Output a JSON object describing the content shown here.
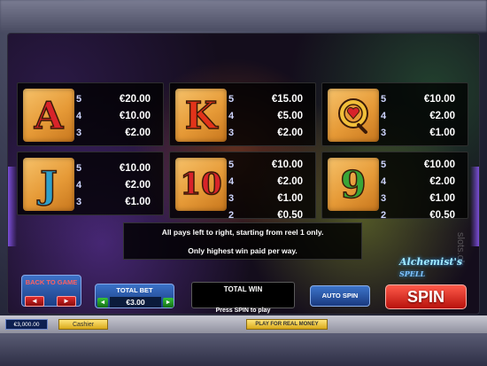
{
  "paytable": [
    {
      "symbol": "A",
      "color": "#d8232a",
      "pays": [
        {
          "count": "5",
          "value": "€20.00"
        },
        {
          "count": "4",
          "value": "€10.00"
        },
        {
          "count": "3",
          "value": "€2.00"
        }
      ]
    },
    {
      "symbol": "K",
      "color": "#e2331a",
      "pays": [
        {
          "count": "5",
          "value": "€15.00"
        },
        {
          "count": "4",
          "value": "€5.00"
        },
        {
          "count": "3",
          "value": "€2.00"
        }
      ]
    },
    {
      "symbol": "Q",
      "color": "#f1bf3a",
      "pays": [
        {
          "count": "5",
          "value": "€10.00"
        },
        {
          "count": "4",
          "value": "€2.00"
        },
        {
          "count": "3",
          "value": "€1.00"
        }
      ]
    },
    {
      "symbol": "J",
      "color": "#2fa0c9",
      "pays": [
        {
          "count": "5",
          "value": "€10.00"
        },
        {
          "count": "4",
          "value": "€2.00"
        },
        {
          "count": "3",
          "value": "€1.00"
        }
      ]
    },
    {
      "symbol": "10",
      "color": "#d8232a",
      "pays": [
        {
          "count": "5",
          "value": "€10.00"
        },
        {
          "count": "4",
          "value": "€2.00"
        },
        {
          "count": "3",
          "value": "€1.00"
        },
        {
          "count": "2",
          "value": "€0.50"
        }
      ]
    },
    {
      "symbol": "9",
      "color": "#3aa537",
      "pays": [
        {
          "count": "5",
          "value": "€10.00"
        },
        {
          "count": "4",
          "value": "€2.00"
        },
        {
          "count": "3",
          "value": "€1.00"
        },
        {
          "count": "2",
          "value": "€0.50"
        }
      ]
    }
  ],
  "info": {
    "line1": "All pays left to right, starting from reel 1 only.",
    "line2": "Only highest win paid per way."
  },
  "watermark": "slots.ok",
  "logo": {
    "name": "Alchemist's",
    "em": "SPELL"
  },
  "controls": {
    "back_to_game": "BACK TO GAME",
    "prev_arrow": "◄",
    "next_arrow": "►",
    "total_bet_label": "TOTAL BET",
    "total_bet_value": "€3.00",
    "bet_down": "◄",
    "bet_up": "►",
    "total_win_label": "TOTAL WIN",
    "press_spin": "Press SPIN to play",
    "auto_spin": "AUTO SPIN",
    "spin": "SPIN"
  },
  "bottom_bar": {
    "balance": "€3,000.00",
    "cashier": "Cashier",
    "real_money": "PLAY FOR REAL MONEY"
  }
}
